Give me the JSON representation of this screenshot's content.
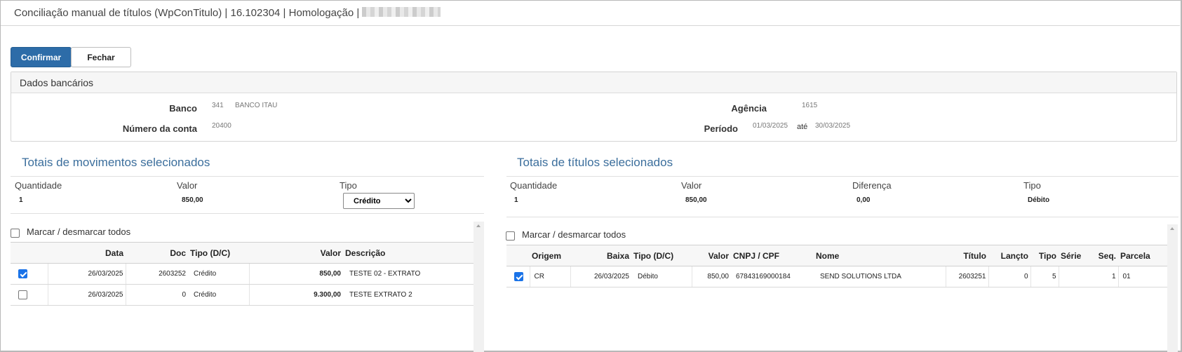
{
  "window": {
    "title": "Conciliação manual de títulos (WpConTitulo) | 16.102304 | Homologação |"
  },
  "toolbar": {
    "confirm_label": "Confirmar",
    "close_label": "Fechar"
  },
  "bank": {
    "panel_title": "Dados bancários",
    "banco_label": "Banco",
    "banco_code": "341",
    "banco_name": "BANCO ITAU",
    "conta_label": "Número da conta",
    "conta_value": "20400",
    "agencia_label": "Agência",
    "agencia_value": "1615",
    "periodo_label": "Período",
    "periodo_start": "01/03/2025",
    "periodo_sep": "até",
    "periodo_end": "30/03/2025"
  },
  "movimentos": {
    "title": "Totais de movimentos selecionados",
    "quantidade_label": "Quantidade",
    "quantidade_value": "1",
    "valor_label": "Valor",
    "valor_value": "850,00",
    "tipo_label": "Tipo",
    "tipo_selected": "Crédito",
    "mark_all_label": "Marcar / desmarcar todos",
    "columns": {
      "data": "Data",
      "doc": "Doc",
      "tipo": "Tipo (D/C)",
      "valor": "Valor",
      "descricao": "Descrição"
    },
    "rows": [
      {
        "checked": true,
        "data": "26/03/2025",
        "doc": "2603252",
        "tipo": "Crédito",
        "valor": "850,00",
        "descricao": "TESTE 02 - EXTRATO"
      },
      {
        "checked": false,
        "data": "26/03/2025",
        "doc": "0",
        "tipo": "Crédito",
        "valor": "9.300,00",
        "descricao": "TESTE EXTRATO 2"
      }
    ]
  },
  "titulos": {
    "title": "Totais de títulos selecionados",
    "quantidade_label": "Quantidade",
    "quantidade_value": "1",
    "valor_label": "Valor",
    "valor_value": "850,00",
    "diferenca_label": "Diferença",
    "diferenca_value": "0,00",
    "tipo_label": "Tipo",
    "tipo_value": "Débito",
    "mark_all_label": "Marcar / desmarcar todos",
    "columns": {
      "origem": "Origem",
      "baixa": "Baixa",
      "tipo": "Tipo (D/C)",
      "valor": "Valor",
      "cnpj": "CNPJ / CPF",
      "nome": "Nome",
      "titulo": "Título",
      "lancto": "Lançto",
      "tipo2": "Tipo",
      "serie": "Série",
      "seq": "Seq.",
      "parcela": "Parcela"
    },
    "rows": [
      {
        "checked": true,
        "origem": "CR",
        "baixa": "26/03/2025",
        "tipo": "Débito",
        "valor": "850,00",
        "cnpj": "67843169000184",
        "nome": "SEND SOLUTIONS LTDA",
        "titulo": "2603251",
        "lancto": "0",
        "tipo2": "5",
        "serie": "",
        "seq": "1",
        "parcela": "01"
      }
    ]
  }
}
